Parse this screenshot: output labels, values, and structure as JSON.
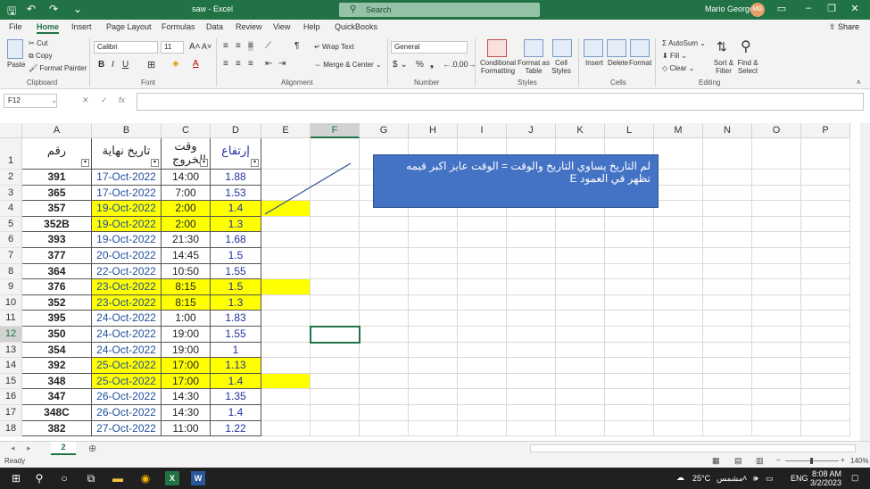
{
  "window": {
    "title": "saw - Excel",
    "search_placeholder": "Search",
    "user_name": "Mario George",
    "user_initials": "MG"
  },
  "tabs": [
    "File",
    "Home",
    "Insert",
    "Page Layout",
    "Formulas",
    "Data",
    "Review",
    "View",
    "Help",
    "QuickBooks"
  ],
  "share_label": "Share",
  "ribbon": {
    "paste": "Paste",
    "cut": "Cut",
    "copy": "Copy",
    "format_painter": "Format Painter",
    "clipboard_group": "Clipboard",
    "font_name": "Calibri",
    "font_size": "11",
    "font_group": "Font",
    "wrap_text": "Wrap Text",
    "merge_center": "Merge & Center",
    "alignment_group": "Alignment",
    "number_format": "General",
    "number_group": "Number",
    "conditional_formatting": "Conditional Formatting",
    "format_as_table": "Format as Table",
    "cell_styles": "Cell Styles",
    "styles_group": "Styles",
    "insert": "Insert",
    "delete": "Delete",
    "format": "Format",
    "cells_group": "Cells",
    "autosum": "AutoSum",
    "fill": "Fill",
    "clear": "Clear",
    "sort_filter": "Sort & Filter",
    "find_select": "Find & Select",
    "editing_group": "Editing"
  },
  "formula_bar": {
    "name_box": "F12",
    "fx": "fx"
  },
  "columns": [
    "A",
    "B",
    "C",
    "D",
    "E",
    "F",
    "G",
    "H",
    "I",
    "J",
    "K",
    "L",
    "M",
    "N",
    "O",
    "P"
  ],
  "header_row": {
    "a": "رقم",
    "b": "تاريخ نهاية",
    "c": "وقت الخروج",
    "d": "إرتفاع"
  },
  "rows": [
    {
      "n": "2",
      "a": "391",
      "b": "17-Oct-2022",
      "c": "14:00",
      "d": "1.88"
    },
    {
      "n": "3",
      "a": "365",
      "b": "17-Oct-2022",
      "c": "7:00",
      "d": "1.53"
    },
    {
      "n": "4",
      "a": "357",
      "b": "19-Oct-2022",
      "c": "2:00",
      "d": "1.4"
    },
    {
      "n": "5",
      "a": "352B",
      "b": "19-Oct-2022",
      "c": "2:00",
      "d": "1.3"
    },
    {
      "n": "6",
      "a": "393",
      "b": "19-Oct-2022",
      "c": "21:30",
      "d": "1.68"
    },
    {
      "n": "7",
      "a": "377",
      "b": "20-Oct-2022",
      "c": "14:45",
      "d": "1.5"
    },
    {
      "n": "8",
      "a": "364",
      "b": "22-Oct-2022",
      "c": "10:50",
      "d": "1.55"
    },
    {
      "n": "9",
      "a": "376",
      "b": "23-Oct-2022",
      "c": "8:15",
      "d": "1.5"
    },
    {
      "n": "10",
      "a": "352",
      "b": "23-Oct-2022",
      "c": "8:15",
      "d": "1.3"
    },
    {
      "n": "11",
      "a": "395",
      "b": "24-Oct-2022",
      "c": "1:00",
      "d": "1.83"
    },
    {
      "n": "12",
      "a": "350",
      "b": "24-Oct-2022",
      "c": "19:00",
      "d": "1.55"
    },
    {
      "n": "13",
      "a": "354",
      "b": "24-Oct-2022",
      "c": "19:00",
      "d": "1"
    },
    {
      "n": "14",
      "a": "392",
      "b": "25-Oct-2022",
      "c": "17:00",
      "d": "1.13"
    },
    {
      "n": "15",
      "a": "348",
      "b": "25-Oct-2022",
      "c": "17:00",
      "d": "1.4"
    },
    {
      "n": "16",
      "a": "347",
      "b": "26-Oct-2022",
      "c": "14:30",
      "d": "1.35"
    },
    {
      "n": "17",
      "a": "348C",
      "b": "26-Oct-2022",
      "c": "14:30",
      "d": "1.4"
    },
    {
      "n": "18",
      "a": "382",
      "b": "27-Oct-2022",
      "c": "11:00",
      "d": "1.22"
    }
  ],
  "comment_text": "لم التاريخ يساوي التاريخ والوقت = الوقت عايز اكبر قيمه تظهر في العمود E",
  "sheet_tab": "2",
  "status": {
    "ready": "Ready",
    "zoom": "140%"
  },
  "taskbar": {
    "temperature": "25°C",
    "weather": "مشمس",
    "language": "ENG",
    "time": "8:08 AM",
    "date": "3/2/2023"
  },
  "colors": {
    "excel_green": "#217346",
    "highlight": "#ffff00",
    "comment_bg": "#4472c4"
  }
}
